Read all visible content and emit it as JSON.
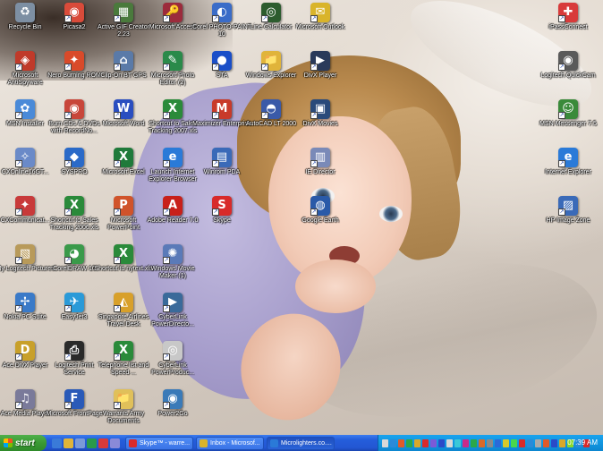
{
  "desktop": {
    "icons": [
      {
        "label": "Recycle Bin",
        "icon": "recycle-bin-icon",
        "color": "#7d8fa3",
        "glyph": "♻",
        "shortcut": false
      },
      {
        "label": "Picasa2",
        "icon": "picasa-icon",
        "color": "#d94b3a",
        "glyph": "◉",
        "shortcut": true
      },
      {
        "label": "Active GIF Creator 2.23",
        "icon": "gif-creator-icon",
        "color": "#4a7a3c",
        "glyph": "▦",
        "shortcut": true
      },
      {
        "label": "Microsoft Access",
        "icon": "access-icon",
        "color": "#9c2b3c",
        "glyph": "🔑",
        "shortcut": true
      },
      {
        "label": "Corel PHOTO-PAINT 10",
        "icon": "corel-photopaint-icon",
        "color": "#3a6cc8",
        "glyph": "◐",
        "shortcut": true
      },
      {
        "label": "Line Calculator",
        "icon": "line-calculator-icon",
        "color": "#2c5c2e",
        "glyph": "◎",
        "shortcut": true
      },
      {
        "label": "Microsoft Outlook",
        "icon": "outlook-icon",
        "color": "#d9b42a",
        "glyph": "✉",
        "shortcut": true
      },
      {
        "label": "Microsoft AntiSpyware",
        "icon": "antispyware-icon",
        "color": "#c03a2a",
        "glyph": "◈",
        "shortcut": true
      },
      {
        "label": "Nero Burning ROM",
        "icon": "nero-icon",
        "color": "#d94a2a",
        "glyph": "✦",
        "shortcut": true
      },
      {
        "label": "Clip-On BT GPS",
        "icon": "gps-icon",
        "color": "#5a7aa8",
        "glyph": "⌂",
        "shortcut": true
      },
      {
        "label": "Microsoft Photo Editor (2)",
        "icon": "photo-editor-icon",
        "color": "#2a8a4a",
        "glyph": "✎",
        "shortcut": true
      },
      {
        "label": "STA",
        "icon": "sta-icon",
        "color": "#1a4ec8",
        "glyph": "●",
        "shortcut": true
      },
      {
        "label": "Windows Explorer",
        "icon": "windows-explorer-icon",
        "color": "#e0b43a",
        "glyph": "📁",
        "shortcut": true
      },
      {
        "label": "DivX Player",
        "icon": "divx-player-icon",
        "color": "#2a3a5a",
        "glyph": "▶",
        "shortcut": true
      },
      {
        "label": "MSN Installer",
        "icon": "msn-installer-icon",
        "color": "#4a8ad8",
        "glyph": "✿",
        "shortcut": true
      },
      {
        "label": "Burn CDs & DVDs with RecordNo...",
        "icon": "burn-cd-icon",
        "color": "#c8463a",
        "glyph": "◉",
        "shortcut": true
      },
      {
        "label": "Microsoft Word",
        "icon": "word-icon",
        "color": "#2a4ec0",
        "glyph": "W",
        "shortcut": true
      },
      {
        "label": "Shortcut to Sales Tracking 2007.xls",
        "icon": "excel-file-icon",
        "color": "#2a8a3a",
        "glyph": "X",
        "shortcut": true
      },
      {
        "label": "Maximizer Enterprise",
        "icon": "maximizer-icon",
        "color": "#c83a2a",
        "glyph": "M",
        "shortcut": true
      },
      {
        "label": "AutoCAD LT 2000",
        "icon": "autocad-icon",
        "color": "#3a5aa8",
        "glyph": "◓",
        "shortcut": true
      },
      {
        "label": "DivX Movies",
        "icon": "divx-movies-icon",
        "color": "#2a4a7a",
        "glyph": "▣",
        "shortcut": true
      },
      {
        "label": "CXOnline16GT...",
        "icon": "cxonline-icon",
        "color": "#6a8ac8",
        "glyph": "✧",
        "shortcut": true
      },
      {
        "label": "SYSPRO",
        "icon": "syspro-icon",
        "color": "#2a6ac8",
        "glyph": "◆",
        "shortcut": true
      },
      {
        "label": "Microsoft Excel",
        "icon": "excel-icon",
        "color": "#1f7a3a",
        "glyph": "X",
        "shortcut": true
      },
      {
        "label": "Launch Internet Explorer Browser",
        "icon": "internet-explorer-icon",
        "color": "#2a7ad8",
        "glyph": "e",
        "shortcut": true
      },
      {
        "label": "Winrom PDA",
        "icon": "winrom-pda-icon",
        "color": "#3a6ab8",
        "glyph": "▤",
        "shortcut": true
      },
      {
        "label": "IE Director",
        "icon": "ie-director-icon",
        "color": "#7a8ab8",
        "glyph": "▥",
        "shortcut": true
      },
      {
        "label": "CXCommunicat...",
        "icon": "cxcommunicator-icon",
        "color": "#c83a3a",
        "glyph": "✦",
        "shortcut": true
      },
      {
        "label": "Shortcut to Sales Tracking 2006.xls",
        "icon": "excel-file-2006-icon",
        "color": "#2a8a3a",
        "glyph": "X",
        "shortcut": true
      },
      {
        "label": "Microsoft PowerPoint",
        "icon": "powerpoint-icon",
        "color": "#d0532a",
        "glyph": "P",
        "shortcut": true
      },
      {
        "label": "Adobe Reader 7.0",
        "icon": "adobe-reader-icon",
        "color": "#c8201a",
        "glyph": "A",
        "shortcut": true
      },
      {
        "label": "Skype",
        "icon": "skype-icon",
        "color": "#d82a2a",
        "glyph": "S",
        "shortcut": true
      },
      {
        "label": "Google Earth",
        "icon": "google-earth-icon",
        "color": "#2a5aa8",
        "glyph": "◍",
        "shortcut": true
      },
      {
        "label": "My Logitech Pictures",
        "icon": "logitech-pictures-icon",
        "color": "#b89a5a",
        "glyph": "▧",
        "shortcut": true
      },
      {
        "label": "CorelDRAW 10",
        "icon": "coreldraw-icon",
        "color": "#3a9a4a",
        "glyph": "◕",
        "shortcut": true
      },
      {
        "label": "Shortcut to nytext.xls",
        "icon": "nytext-file-icon",
        "color": "#2a8a3a",
        "glyph": "X",
        "shortcut": true
      },
      {
        "label": "Windows Movie Maker (1)",
        "icon": "movie-maker-icon",
        "color": "#5a7ab8",
        "glyph": "✺",
        "shortcut": true
      },
      {
        "label": "Nokia PC Suite",
        "icon": "nokia-pc-suite-icon",
        "color": "#3a7ac8",
        "glyph": "✢",
        "shortcut": true
      },
      {
        "label": "EasyJet3",
        "icon": "easyjet-icon",
        "color": "#2a9ad8",
        "glyph": "✈",
        "shortcut": true
      },
      {
        "label": "Singapore Airlines Travel Desk",
        "icon": "singapore-airlines-icon",
        "color": "#d8a02a",
        "glyph": "◭",
        "shortcut": true
      },
      {
        "label": "CyberLink PowerDirecto...",
        "icon": "powerdirector-icon",
        "color": "#3a6a9a",
        "glyph": "▶",
        "shortcut": true
      },
      {
        "label": "Ace DivX Player",
        "icon": "ace-divx-icon",
        "color": "#c8a02a",
        "glyph": "D",
        "shortcut": true
      },
      {
        "label": "Logitech Print Service",
        "icon": "logitech-print-icon",
        "color": "#2a2a2a",
        "glyph": "⎙",
        "shortcut": true
      },
      {
        "label": "Telephone list and Speed ...",
        "icon": "telephone-list-icon",
        "color": "#2a8a3a",
        "glyph": "X",
        "shortcut": true
      },
      {
        "label": "CyberLink PowerProduc...",
        "icon": "powerproducer-icon",
        "color": "#c8c8c8",
        "glyph": "◎",
        "shortcut": true
      },
      {
        "label": "Ace Media Player",
        "icon": "ace-media-player-icon",
        "color": "#7a7a9a",
        "glyph": "♫",
        "shortcut": true
      },
      {
        "label": "Microsoft FrontPage",
        "icon": "frontpage-icon",
        "color": "#2a5ab8",
        "glyph": "F",
        "shortcut": true
      },
      {
        "label": "Warrants Army Documents",
        "icon": "folder-icon",
        "color": "#e0c05a",
        "glyph": "📁",
        "shortcut": true
      },
      {
        "label": "Power2Go",
        "icon": "power2go-icon",
        "color": "#3a7ab8",
        "glyph": "◉",
        "shortcut": true
      },
      {
        "label": "iPassConnect",
        "icon": "ipass-icon",
        "color": "#d83a3a",
        "glyph": "✚",
        "shortcut": true
      },
      {
        "label": "Logitech QuickCam",
        "icon": "quickcam-icon",
        "color": "#5a5a5a",
        "glyph": "◉",
        "shortcut": true
      },
      {
        "label": "MSN Messenger 7.5",
        "icon": "msn-messenger-icon",
        "color": "#3a8a3a",
        "glyph": "☺",
        "shortcut": true
      },
      {
        "label": "Internet Explorer",
        "icon": "ie-icon",
        "color": "#2a7ad8",
        "glyph": "e",
        "shortcut": true
      },
      {
        "label": "HP Image Zone",
        "icon": "hp-image-zone-icon",
        "color": "#3a6ab8",
        "glyph": "▨",
        "shortcut": true
      }
    ]
  },
  "taskbar": {
    "start_label": "start",
    "quick_launch": [
      "#3a7ad8",
      "#e0b43a",
      "#7a9ad8",
      "#2a9a4a",
      "#d83a3a",
      "#8a8ad8"
    ],
    "tasks": [
      {
        "label": "Skype™ - warre...",
        "color": "#d82a2a",
        "active": false
      },
      {
        "label": "Inbox - Microsof...",
        "color": "#d9b42a",
        "active": false
      },
      {
        "label": "Microlighters.co....",
        "color": "#2a7ad8",
        "active": true
      }
    ],
    "tray_icons": [
      "#d8d8d8",
      "#2a8ad8",
      "#e05a2a",
      "#2aa84a",
      "#d8a82a",
      "#d82a2a",
      "#7a5ad8",
      "#2a4ac8",
      "#d8d8d8",
      "#3ac8d8",
      "#c82a8a",
      "#2aa84a",
      "#d86a2a",
      "#8a8a8a",
      "#2a6ad8",
      "#d8c82a",
      "#4ad84a",
      "#d82a2a",
      "#2a8ad8",
      "#aaaaaa",
      "#e05a2a",
      "#2a4ac8",
      "#d8a82a",
      "#8ad82a",
      "#2a8ad8",
      "#d82a2a"
    ],
    "clock": "07:39 AM"
  }
}
